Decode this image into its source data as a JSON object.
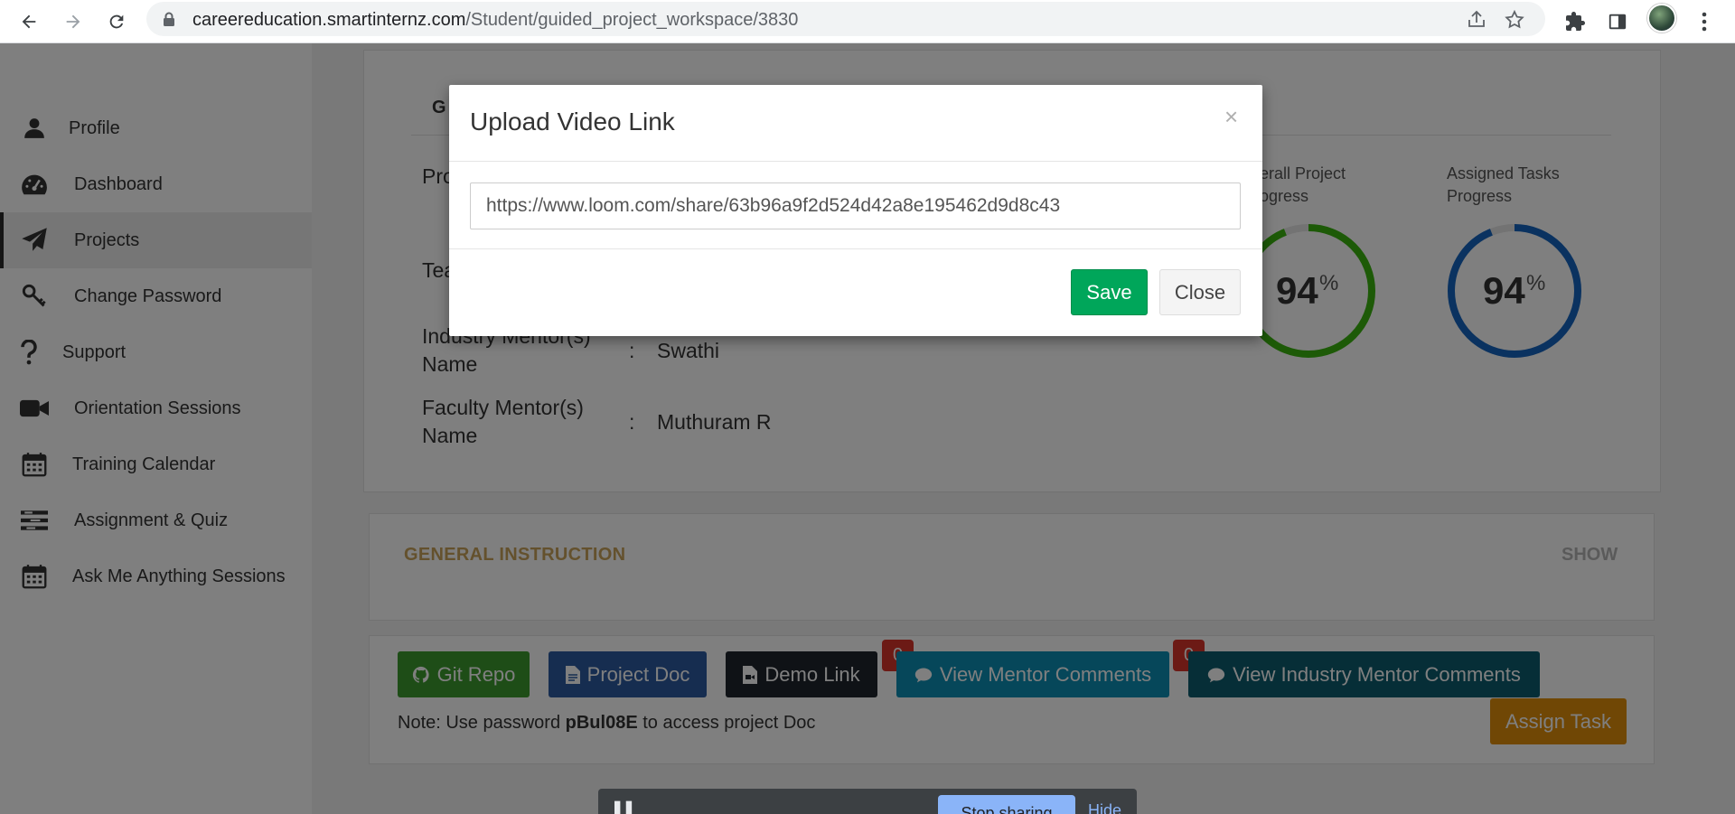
{
  "browser": {
    "url_host": "careereducation.smartinternz.com",
    "url_path": "/Student/guided_project_workspace/3830"
  },
  "sidebar": {
    "items": [
      {
        "label": "Profile",
        "icon": "user-icon"
      },
      {
        "label": "Dashboard",
        "icon": "dashboard-icon"
      },
      {
        "label": "Projects",
        "icon": "paper-plane-icon",
        "active": true
      },
      {
        "label": "Change Password",
        "icon": "key-icon"
      },
      {
        "label": "Support",
        "icon": "question-icon"
      },
      {
        "label": "Orientation Sessions",
        "icon": "video-camera-icon"
      },
      {
        "label": "Training Calendar",
        "icon": "calendar-icon"
      },
      {
        "label": "Assignment & Quiz",
        "icon": "list-icon"
      },
      {
        "label": "Ask Me Anything Sessions",
        "icon": "calendar-icon"
      }
    ]
  },
  "project": {
    "tab_label": "G",
    "row_labels": [
      "Pro",
      "Tea"
    ],
    "industry_mentor_label": [
      "Industry Mentor(s)",
      "Name"
    ],
    "industry_mentor_value": "Swathi",
    "faculty_mentor_label": [
      "Faculty Mentor(s)",
      "Name"
    ],
    "faculty_mentor_value": "Muthuram R",
    "colon": ":"
  },
  "progress": {
    "overall_title": "erall Project\nogress",
    "overall_value": 94,
    "assigned_title": "Assigned Tasks\nProgress",
    "assigned_value": 94,
    "percent_sign": "%",
    "overall_color": "#3ab50e",
    "assigned_color": "#1565c0"
  },
  "general_instruction": {
    "title": "GENERAL INSTRUCTION",
    "toggle": "SHOW"
  },
  "actions": {
    "git_repo": "Git Repo",
    "project_doc": "Project Doc",
    "demo_link": "Demo Link",
    "view_mentor_comments": "View Mentor Comments",
    "view_mentor_comments_badge": "0",
    "view_industry_mentor_comments": "View Industry Mentor Comments",
    "view_industry_mentor_comments_badge": "0",
    "assign_task": "Assign Task",
    "note_prefix": "Note: Use password ",
    "note_password": "pBul08E",
    "note_suffix": " to access project Doc"
  },
  "modal": {
    "title": "Upload Video Link",
    "close_x": "×",
    "input_value": "https://www.loom.com/share/63b96a9f2d524d42a8e195462d9d8c43",
    "save_label": "Save",
    "close_label": "Close"
  },
  "share_bar": {
    "text": "▌▌                                                    ",
    "stop_label": "Stop sharing",
    "hide_label": "Hide"
  }
}
